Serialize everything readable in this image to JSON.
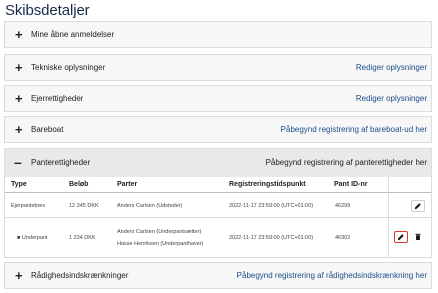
{
  "page": {
    "title": "Skibsdetaljer"
  },
  "sections_top": [
    {
      "title": "Mine åbne anmeldelser",
      "action": ""
    },
    {
      "title": "Tekniske oplysninger",
      "action": "Rediger oplysninger"
    },
    {
      "title": "Ejerrettigheder",
      "action": "Rediger oplysninger"
    },
    {
      "title": "Bareboat",
      "action": "Påbegynd registrering af bareboat-ud her"
    }
  ],
  "panterettigheder": {
    "title": "Panterettigheder",
    "action": "Påbegynd registrering af panterettigheder her",
    "columns": [
      "Type",
      "Beløb",
      "Parter",
      "Registreringstidspunkt",
      "Pant ID-nr"
    ],
    "rows": [
      {
        "type": "Ejerpantebrev",
        "belob": "12 345 DKK",
        "parter": [
          "Anders Carlsen (Udsteder)"
        ],
        "tidspunkt": "2022-11-17 23:59:00 (UTC+01:00)",
        "pant_id": "46299"
      },
      {
        "type": "Underpant",
        "belob": "1 234 DKK",
        "parter": [
          "Anders Carlsen (Underpantsætter)",
          "Hasse Henriksen (Underpanthaver)"
        ],
        "tidspunkt": "2022-11-17 23:59:00 (UTC+01:00)",
        "pant_id": "46302"
      }
    ]
  },
  "section_bottom": {
    "title": "Rådighedsindskrænkninger",
    "action": "Påbegynd registrering af rådighedsindskrænkning her"
  },
  "icons": {
    "expand": "plus-icon",
    "collapse": "minus-icon",
    "edit": "pencil-icon",
    "delete": "trash-icon",
    "bullet": "bullet-icon"
  },
  "colors": {
    "link": "#1c4e8a",
    "highlight": "#d93a3a",
    "header_bg": "#e9e9e9",
    "section_bg": "#f7f7f7"
  }
}
